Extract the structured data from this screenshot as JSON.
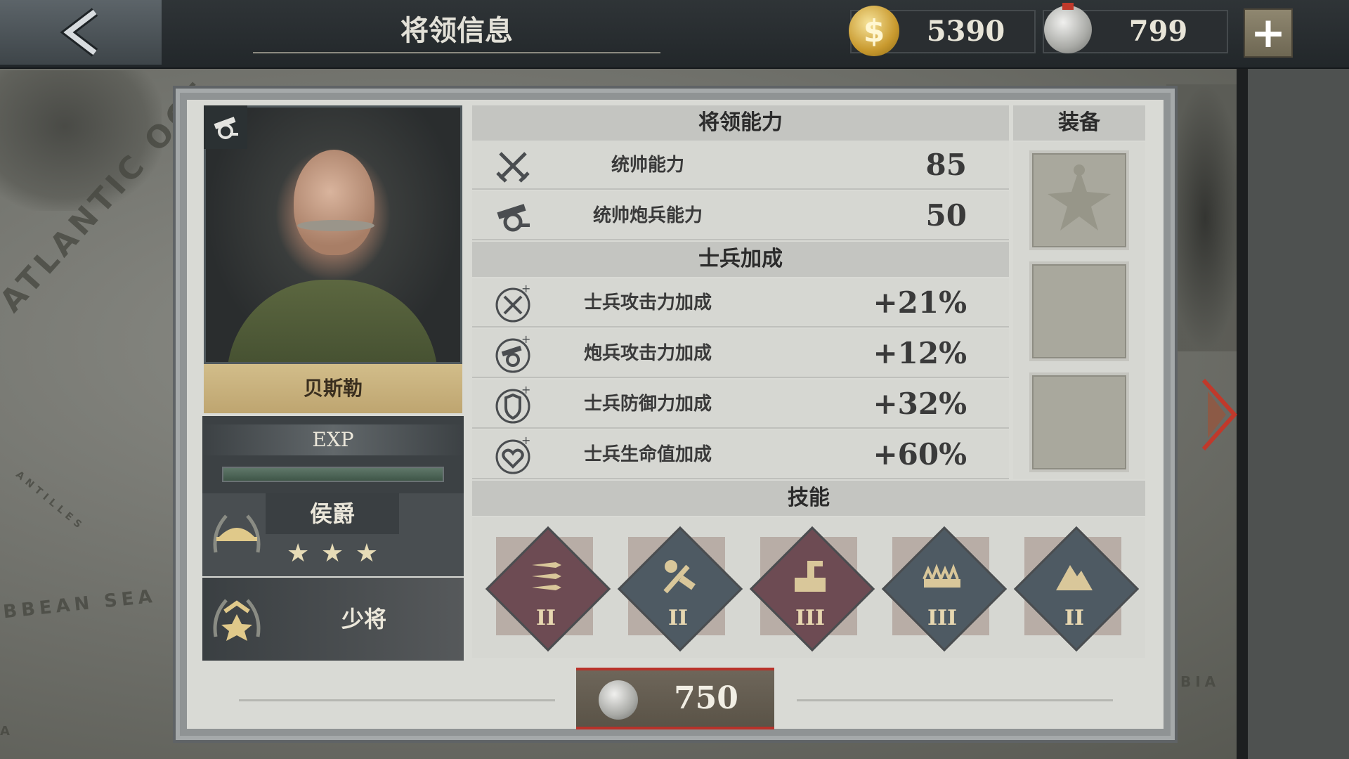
{
  "header": {
    "title": "将领信息",
    "gold": "5390",
    "medals": "799",
    "gold_symbol": "$",
    "add_label": "+"
  },
  "map_labels": {
    "atlantic": "ATLANTIC OCE",
    "sea": "BBEAN SEA",
    "antilles": "ANTILLES",
    "bia": "BIA",
    "a": "A"
  },
  "general": {
    "name": "贝斯勒",
    "exp_label": "EXP",
    "exp_progress": 1.0,
    "title": "侯爵",
    "stars": 3,
    "military_rank": "少将"
  },
  "abilities": {
    "header": "将领能力",
    "rows": [
      {
        "icon": "crossed-swords-icon",
        "label": "统帅能力",
        "value": "85"
      },
      {
        "icon": "cannon-icon",
        "label": "统帅炮兵能力",
        "value": "50"
      }
    ]
  },
  "soldier_bonus": {
    "header": "士兵加成",
    "rows": [
      {
        "icon": "attack-bonus-icon",
        "label": "士兵攻击力加成",
        "value": "+21%"
      },
      {
        "icon": "artillery-bonus-icon",
        "label": "炮兵攻击力加成",
        "value": "+12%"
      },
      {
        "icon": "shield-bonus-icon",
        "label": "士兵防御力加成",
        "value": "+32%"
      },
      {
        "icon": "heart-bonus-icon",
        "label": "士兵生命值加成",
        "value": "+60%"
      }
    ]
  },
  "equipment": {
    "header": "装备",
    "slots": [
      "order-medal-icon",
      "empty",
      "empty"
    ]
  },
  "skills": {
    "header": "技能",
    "items": [
      {
        "icon": "rockets-icon",
        "level": "II",
        "color": "#6d4b53"
      },
      {
        "icon": "hammer-wrench-icon",
        "level": "II",
        "color": "#4e5a63"
      },
      {
        "icon": "fortress-icon",
        "level": "III",
        "color": "#6d4b53"
      },
      {
        "icon": "barbed-wire-icon",
        "level": "III",
        "color": "#4e5a63"
      },
      {
        "icon": "mountain-icon",
        "level": "II",
        "color": "#4e5a63"
      }
    ]
  },
  "promote": {
    "cost": "750"
  }
}
